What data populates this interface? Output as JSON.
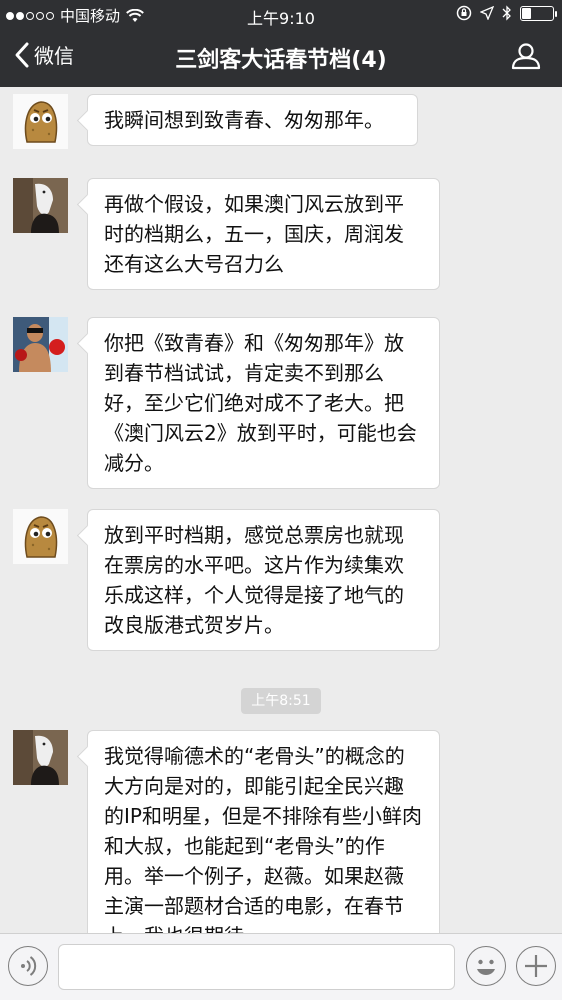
{
  "status_bar": {
    "carrier": "中国移动",
    "time": "上午9:10"
  },
  "nav": {
    "back_label": "微信",
    "title": "三剑客大话春节档(4)"
  },
  "messages": [
    {
      "avatar": "potato-avatar",
      "text": "我瞬间想到致青春、匆匆那年。"
    },
    {
      "avatar": "horse-mask-avatar",
      "text": "再做个假设，如果澳门风云放到平时的档期么，五一，国庆，周润发还有这么大号召力么"
    },
    {
      "avatar": "boxer-avatar",
      "text": "你把《致青春》和《匆匆那年》放到春节档试试，肯定卖不到那么好，至少它们绝对成不了老大。把《澳门风云2》放到平时，可能也会减分。"
    },
    {
      "avatar": "potato-avatar",
      "text": "放到平时档期，感觉总票房也就现在票房的水平吧。这片作为续集欢乐成这样，个人觉得是接了地气的改良版港式贺岁片。"
    },
    {
      "avatar": "horse-mask-avatar",
      "text": "我觉得喻德术的“老骨头”的概念的大方向是对的，即能引起全民兴趣的IP和明星，但是不排除有些小鲜肉和大叔，也能起到“老骨头”的作用。举一个例子，赵薇。如果赵薇主演一部题材合适的电影，在春节上，我也很期待。"
    }
  ],
  "timestamp": "上午8:51",
  "input": {
    "value": "",
    "placeholder": ""
  },
  "colors": {
    "nav_bg": "#2f3033",
    "chat_bg": "#ececec",
    "bubble_bg": "#ffffff"
  }
}
